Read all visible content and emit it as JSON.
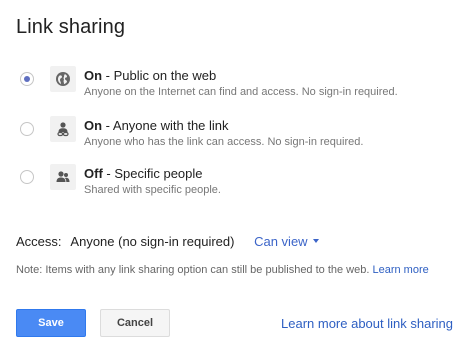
{
  "dialog": {
    "title": "Link sharing"
  },
  "options": [
    {
      "state": "On",
      "label": "Public on the web",
      "description": "Anyone on the Internet can find and access. No sign-in required.",
      "icon": "globe-icon",
      "selected": true
    },
    {
      "state": "On",
      "label": "Anyone with the link",
      "description": "Anyone who has the link can access. No sign-in required.",
      "icon": "person-link-icon",
      "selected": false
    },
    {
      "state": "Off",
      "label": "Specific people",
      "description": "Shared with specific people.",
      "icon": "people-icon",
      "selected": false
    }
  ],
  "access": {
    "label": "Access:",
    "value": "Anyone (no sign-in required)",
    "permission": "Can view"
  },
  "note": {
    "text": "Note: Items with any link sharing option can still be published to the web.",
    "link": "Learn more"
  },
  "buttons": {
    "save": "Save",
    "cancel": "Cancel"
  },
  "footer_link": "Learn more about link sharing",
  "colors": {
    "accent": "#4a8af4",
    "link": "#2e5fc2",
    "radio_selected": "#5f6fc0"
  }
}
